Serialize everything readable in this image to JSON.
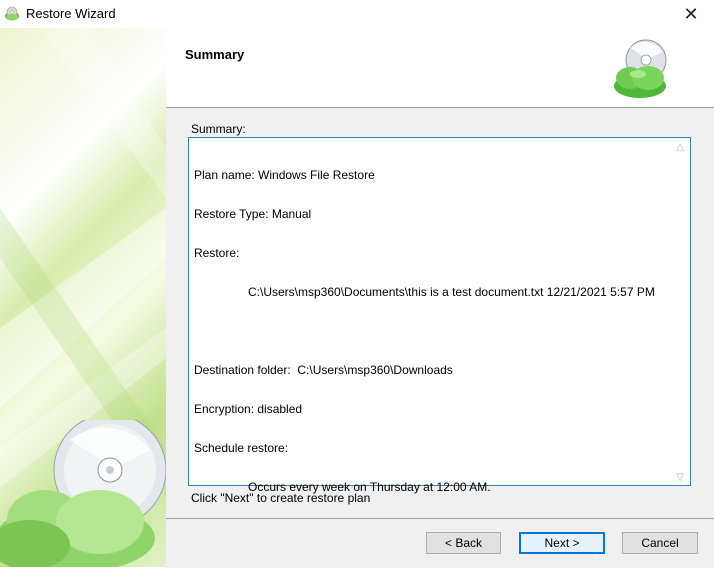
{
  "window": {
    "title": "Restore Wizard",
    "close_glyph": "✕",
    "icon": "cloud-disc-icon"
  },
  "header": {
    "title": "Summary",
    "logo_icon": "cloud-disc-logo"
  },
  "summary": {
    "label": "Summary:",
    "lines": [
      "Plan name: Windows File Restore",
      "Restore Type: Manual",
      "Restore:",
      "C:\\Users\\msp360\\Documents\\this is a test document.txt 12/21/2021 5:57 PM",
      "",
      "Destination folder:  C:\\Users\\msp360\\Downloads",
      "Encryption: disabled",
      "Schedule restore:",
      "Occurs every week on Thursday at 12:00 AM."
    ]
  },
  "hint": "Click \"Next\" to create restore plan",
  "buttons": {
    "back": "< Back",
    "next": "Next >",
    "cancel": "Cancel"
  },
  "colors": {
    "accent": "#0078d7",
    "sidebar_green": "#bfe08a"
  }
}
